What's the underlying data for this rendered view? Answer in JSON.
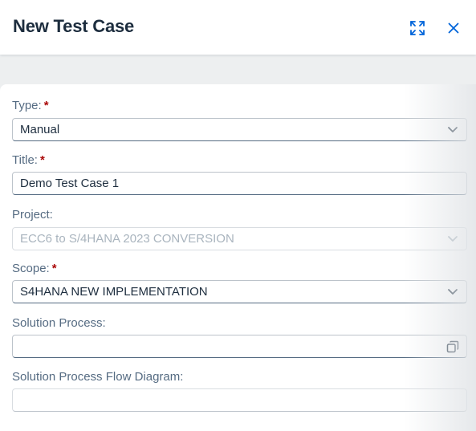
{
  "dialog": {
    "title": "New Test Case",
    "fullscreen_icon": "fullscreen-icon",
    "close_icon": "close-icon"
  },
  "form": {
    "type": {
      "label": "Type:",
      "required": "*",
      "value": "Manual"
    },
    "title": {
      "label": "Title:",
      "required": "*",
      "value": "Demo Test Case 1"
    },
    "project": {
      "label": "Project:",
      "value": "ECC6 to S/4HANA 2023 CONVERSION"
    },
    "scope": {
      "label": "Scope:",
      "required": "*",
      "value": "S4HANA NEW IMPLEMENTATION"
    },
    "solution_process": {
      "label": "Solution Process:",
      "value": "",
      "icon": "value-help-icon"
    },
    "flow_diagram": {
      "label": "Solution Process Flow Diagram:",
      "value": ""
    }
  },
  "colors": {
    "required": "#aa0808",
    "label": "#556b82",
    "text": "#1d2d3e",
    "accent": "#0064d9"
  }
}
